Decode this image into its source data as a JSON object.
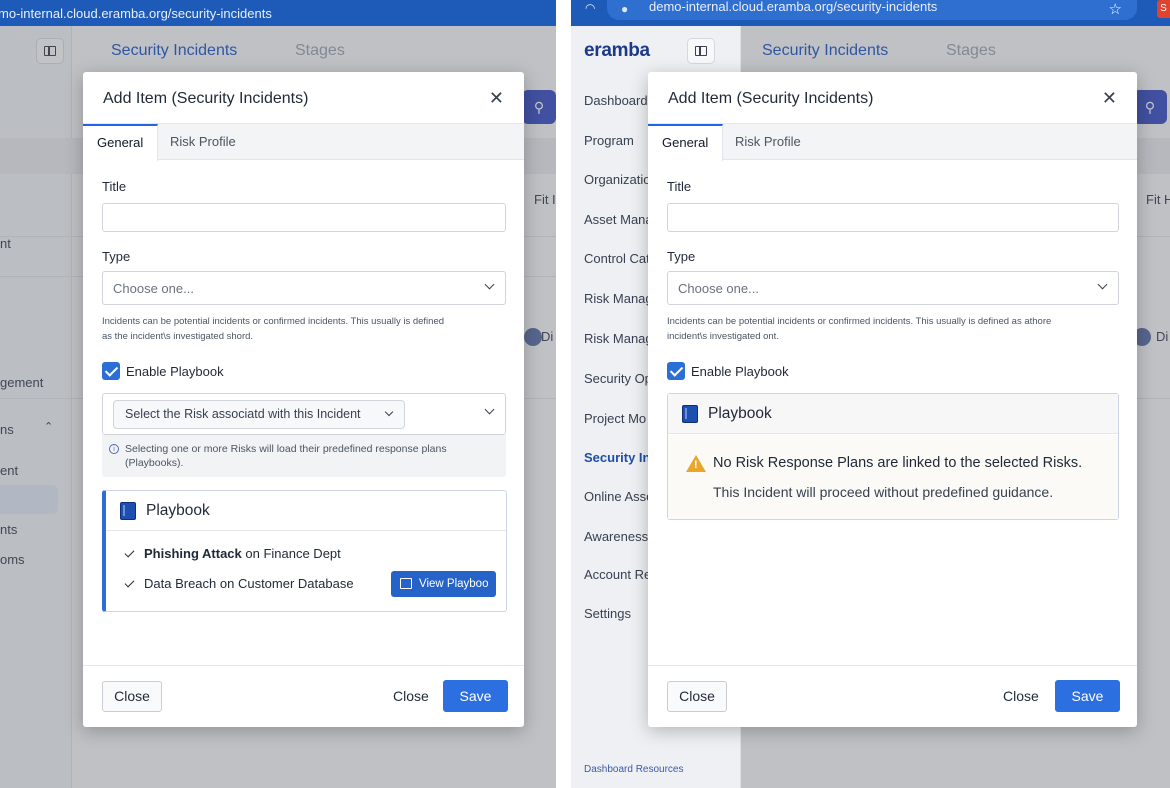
{
  "left": {
    "url": "mo-internal.cloud.eramba.org/security-incidents",
    "header_tabs": [
      "Security Incidents",
      "Stages"
    ],
    "sidebar_fragments": [
      "nt",
      "gement",
      "ns",
      "ent",
      "nts",
      "oms"
    ],
    "bg_fragments": [
      "Fit I",
      "Di"
    ],
    "modal": {
      "title": "Add Item (Security Incidents)",
      "close_glyph": "✕",
      "tabs": [
        "General",
        "Risk Profile"
      ],
      "title_label": "Title",
      "title_value": "",
      "type_label": "Type",
      "type_placeholder": "Choose one...",
      "type_help": [
        "Incidents can be potential incidents or confirmed incidents. This usually is defined",
        "as the incident\\s investigated shord."
      ],
      "enable_playbook_label": "Enable Playbook",
      "enable_playbook_checked": true,
      "risk_select_placeholder": "Select the Risk associatd with this Incident",
      "info_text": "Selecting one or more Risks will load their predefined response plans (Playbooks).",
      "playbook": {
        "title": "Playbook",
        "items": [
          {
            "bold": "Phishing Attack",
            "rest": " on Finance Dept"
          },
          {
            "bold": "",
            "rest": "Data Breach on Customer Database"
          }
        ],
        "view_button": "View Playboo"
      },
      "footer": {
        "close_outline": "Close",
        "close_text": "Close",
        "save": "Save"
      }
    }
  },
  "right": {
    "url": "demo-internal.cloud.eramba.org/security-incidents",
    "logo": "eramba",
    "header_tabs": [
      "Security Incidents",
      "Stages"
    ],
    "sidebar_items": [
      "Dashboard d",
      "Program",
      "Organizatio",
      "Asset Mana",
      "Control Cat",
      "Risk Manag",
      "Risk Manag",
      "Security Op",
      "Project Mo",
      "Security In",
      "Online Asse",
      "Awareness",
      "Account Re",
      "Settings"
    ],
    "sidebar_footer": "Dashboard Resources",
    "bg_fragments": [
      "Fit H",
      "Di"
    ],
    "modal": {
      "title": "Add Item (Security Incidents)",
      "close_glyph": "✕",
      "tabs": [
        "General",
        "Risk Profile"
      ],
      "title_label": "Title",
      "title_value": "",
      "type_label": "Type",
      "type_placeholder": "Choose one...",
      "type_help": [
        "Incidents can be potential incidents or confirmed incidents. This usually is defined as athore",
        "incident\\s investigated ont."
      ],
      "enable_playbook_label": "Enable Playbook",
      "enable_playbook_checked": true,
      "playbook": {
        "title": "Playbook",
        "warning_title": "No Risk Response Plans are linked to the selected Risks.",
        "warning_sub": "This Incident will proceed without predefined guidance."
      },
      "footer": {
        "close_outline": "Close",
        "close_text": "Close",
        "save": "Save"
      }
    }
  },
  "colors": {
    "primary": "#2b6fe0",
    "url_bar": "#1e5bb8",
    "link_active": "#1f57c3",
    "warning": "#e7a72b"
  },
  "icons": [
    "sidebar-toggle-icon",
    "search-icon",
    "close-icon",
    "chevron-down-icon",
    "info-icon",
    "book-icon",
    "check-icon",
    "external-view-icon",
    "warning-icon",
    "lock-icon",
    "star-icon",
    "wifi-icon"
  ]
}
